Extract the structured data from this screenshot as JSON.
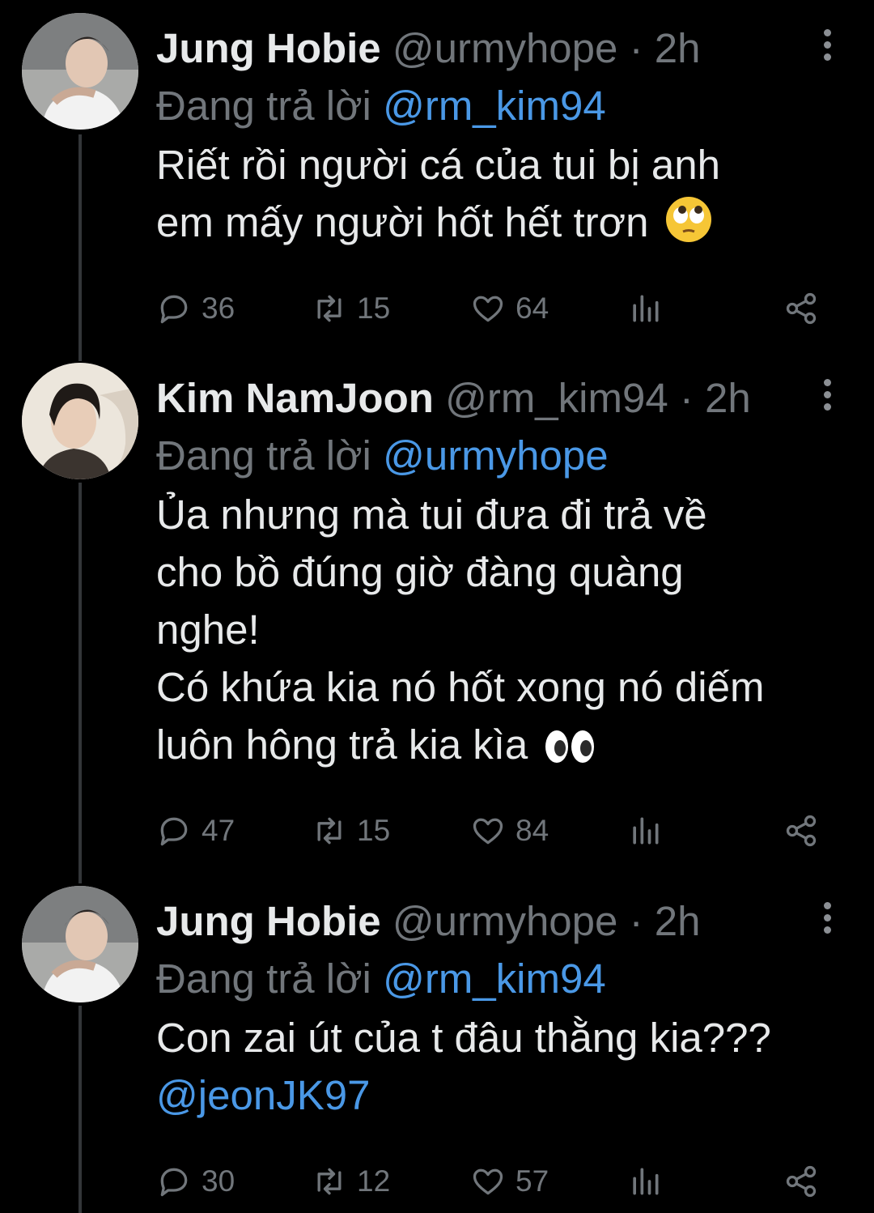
{
  "colors": {
    "background": "#000000",
    "text": "#e7e9ea",
    "muted": "#71767b",
    "mention": "#4a98e6",
    "thread_line": "#333639"
  },
  "tweets": [
    {
      "name": "Jung Hobie",
      "handle": "@urmyhope",
      "separator": "·",
      "time": "2h",
      "replying_label": "Đang trả lời",
      "replying_to": "@rm_kim94",
      "text_lines": [
        "Riết rồi người cá của tui bị anh",
        "em mấy người hốt hết trơn"
      ],
      "emoji": "face-with-rolling-eyes",
      "replies": "36",
      "retweets": "15",
      "likes": "64"
    },
    {
      "name": "Kim NamJoon",
      "handle": "@rm_kim94",
      "separator": "·",
      "time": "2h",
      "replying_label": "Đang trả lời",
      "replying_to": "@urmyhope",
      "text_lines": [
        "Ủa nhưng mà tui đưa đi trả về",
        "cho bồ đúng giờ đàng quàng",
        "nghe!",
        "Có khứa kia nó hốt xong nó diếm",
        "luôn hông trả kia kìa"
      ],
      "emoji": "eyes",
      "replies": "47",
      "retweets": "15",
      "likes": "84"
    },
    {
      "name": "Jung Hobie",
      "handle": "@urmyhope",
      "separator": "·",
      "time": "2h",
      "replying_label": "Đang trả lời",
      "replying_to": "@rm_kim94",
      "text_lines": [
        "Con zai út của t đâu thằng kia???"
      ],
      "mention_line": "@jeonJK97",
      "replies": "30",
      "retweets": "12",
      "likes": "57"
    }
  ]
}
